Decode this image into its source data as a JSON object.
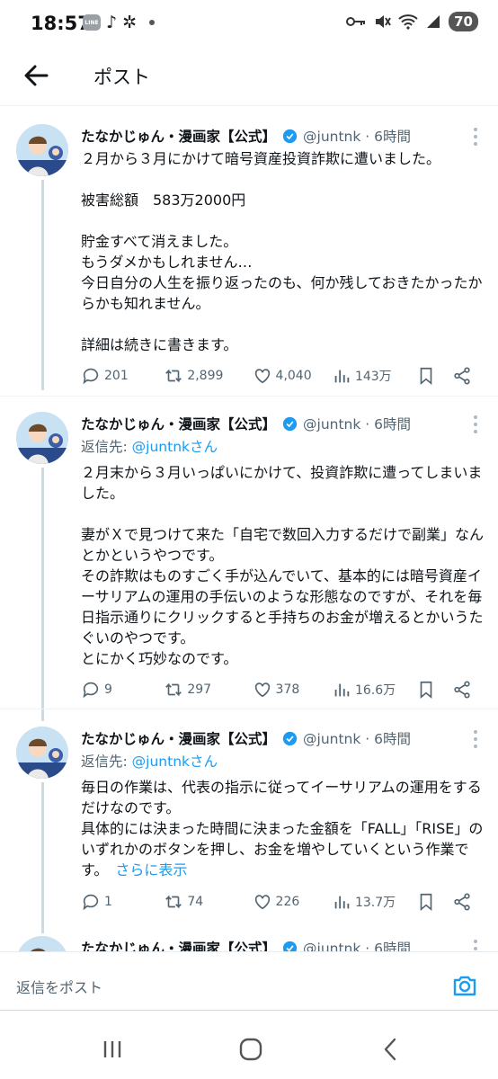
{
  "status_bar": {
    "time": "18:57",
    "line_label": "LINE",
    "battery": "70"
  },
  "header": {
    "title": "ポスト"
  },
  "tweets": [
    {
      "name": "たなかじゅん・漫画家【公式】",
      "handle": "@juntnk · 6時間",
      "body": [
        "２月から３月にかけて暗号資産投資詐欺に遭いました。",
        "",
        "被害総額　583万2000円",
        "",
        "貯金すべて消えました。",
        "もうダメかもしれません…",
        "今日自分の人生を振り返ったのも、何か残しておきたかったからかも知れません。",
        "",
        "詳細は続きに書きます。"
      ],
      "stats": {
        "replies": "201",
        "reposts": "2,899",
        "likes": "4,040",
        "views": "143万"
      }
    },
    {
      "name": "たなかじゅん・漫画家【公式】",
      "handle": "@juntnk · 6時間",
      "reply_prefix": "返信先: ",
      "reply_to": "@juntnkさん",
      "body": [
        "２月末から３月いっぱいにかけて、投資詐欺に遭ってしまいました。",
        "",
        "妻がＸで見つけて来た「自宅で数回入力するだけで副業」なんとかというやつです。",
        "その詐欺はものすごく手が込んでいて、基本的には暗号資産イーサリアムの運用の手伝いのような形態なのですが、それを毎日指示通りにクリックすると手持ちのお金が増えるとかいうたぐいのやつです。",
        "とにかく巧妙なのです。"
      ],
      "stats": {
        "replies": "9",
        "reposts": "297",
        "likes": "378",
        "views": "16.6万"
      }
    },
    {
      "name": "たなかじゅん・漫画家【公式】",
      "handle": "@juntnk · 6時間",
      "reply_prefix": "返信先: ",
      "reply_to": "@juntnkさん",
      "body": [
        "毎日の作業は、代表の指示に従ってイーサリアムの運用をするだけなのです。",
        "具体的には決まった時間に決まった金額を「FALL」「RISE」のいずれかのボタンを押し、お金を増やしていくという作業です。"
      ],
      "show_more": "さらに表示",
      "stats": {
        "replies": "1",
        "reposts": "74",
        "likes": "226",
        "views": "13.7万"
      }
    },
    {
      "name": "たなかじゅん・漫画家【公式】",
      "handle": "@juntnk · 6時間"
    }
  ],
  "reply_bar": {
    "placeholder": "返信をポスト"
  },
  "icons": {
    "back": "arrow-left-icon",
    "more": "more-vertical-icon",
    "verified": "verified-badge-icon",
    "reply": "comment-icon",
    "repost": "repost-icon",
    "like": "heart-icon",
    "views": "views-icon",
    "bookmark": "bookmark-icon",
    "share": "share-icon",
    "camera": "camera-icon"
  },
  "colors": {
    "accent": "#1d9bf0",
    "text": "#0f1419",
    "secondary": "#536471"
  }
}
